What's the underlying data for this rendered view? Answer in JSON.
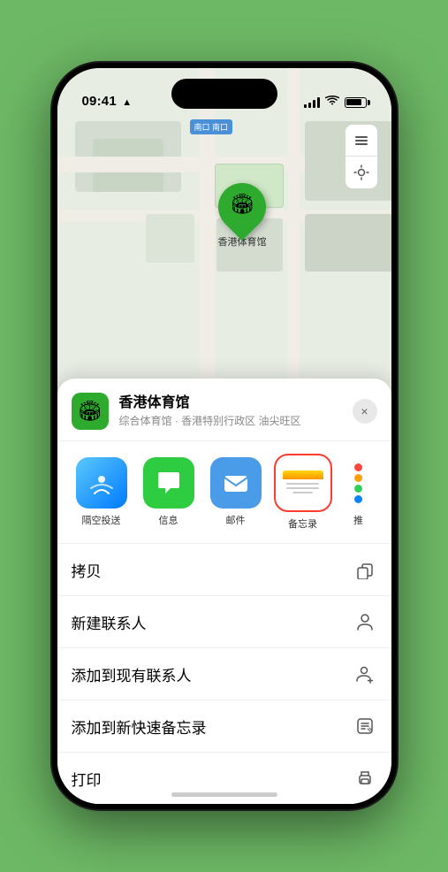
{
  "status": {
    "time": "09:41",
    "location_arrow": "▲"
  },
  "map": {
    "entrance_label": "南口",
    "entrance_prefix": "南口",
    "pin_label": "香港体育馆",
    "pin_emoji": "🏟"
  },
  "venue": {
    "name": "香港体育馆",
    "subtitle": "综合体育馆 · 香港特别行政区 油尖旺区",
    "icon_emoji": "🏟",
    "close_label": "×"
  },
  "share_items": [
    {
      "id": "airdrop",
      "label": "隔空投送"
    },
    {
      "id": "messages",
      "label": "信息"
    },
    {
      "id": "mail",
      "label": "邮件"
    },
    {
      "id": "notes",
      "label": "备忘录"
    },
    {
      "id": "more",
      "label": "推"
    }
  ],
  "actions": [
    {
      "label": "拷贝",
      "icon": "copy"
    },
    {
      "label": "新建联系人",
      "icon": "person"
    },
    {
      "label": "添加到现有联系人",
      "icon": "person-add"
    },
    {
      "label": "添加到新快速备忘录",
      "icon": "note"
    },
    {
      "label": "打印",
      "icon": "print"
    }
  ],
  "home_indicator": ""
}
